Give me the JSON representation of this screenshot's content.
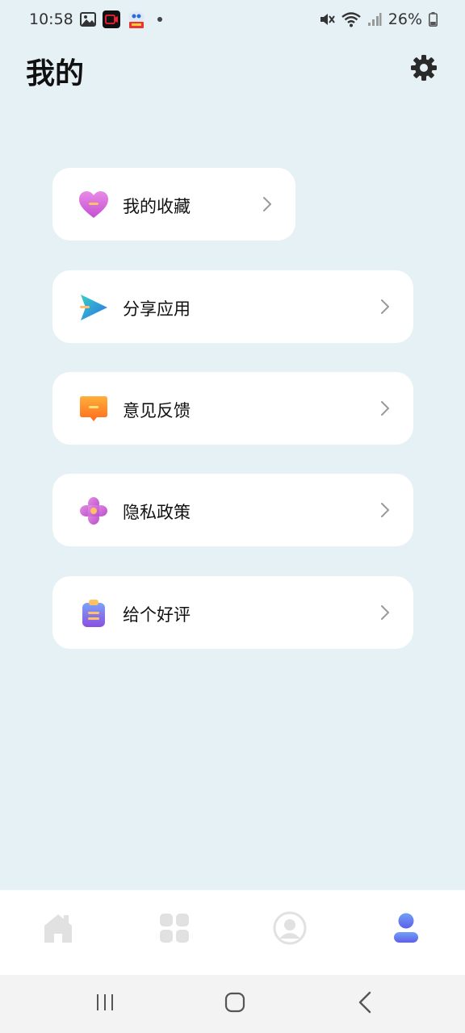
{
  "status_bar": {
    "time": "10:58",
    "battery": "26%"
  },
  "header": {
    "title": "我的"
  },
  "menu": [
    {
      "label": "我的收藏",
      "icon": "heart-icon"
    },
    {
      "label": "分享应用",
      "icon": "share-send-icon"
    },
    {
      "label": "意见反馈",
      "icon": "feedback-message-icon"
    },
    {
      "label": "隐私政策",
      "icon": "privacy-flower-icon"
    },
    {
      "label": "给个好评",
      "icon": "clipboard-review-icon"
    }
  ],
  "bottom_nav": {
    "tabs": [
      {
        "icon": "home-icon",
        "active": false
      },
      {
        "icon": "grid-apps-icon",
        "active": false
      },
      {
        "icon": "profile-circle-icon",
        "active": false
      },
      {
        "icon": "user-icon",
        "active": true
      }
    ]
  },
  "colors": {
    "background": "#e6f1f6",
    "card": "#ffffff",
    "accent": "#5b7ff2",
    "inactive_icon": "#e1e1e1"
  }
}
